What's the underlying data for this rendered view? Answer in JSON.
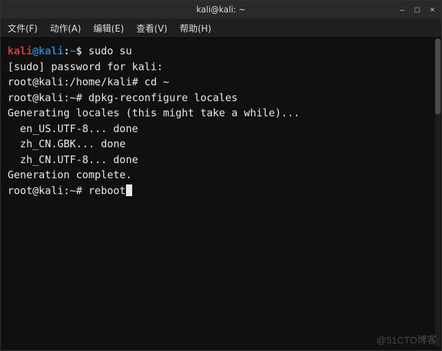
{
  "titlebar": {
    "title": "kali@kali: ~"
  },
  "window_controls": {
    "minimize": "–",
    "maximize": "□",
    "close": "×"
  },
  "menubar": {
    "file": "文件(F)",
    "actions": "动作(A)",
    "edit": "编辑(E)",
    "view": "查看(V)",
    "help": "帮助(H)"
  },
  "prompt1": {
    "user": "kali",
    "at": "@",
    "host": "kali",
    "colon": ":",
    "path": "~",
    "sym": "$",
    "cmd": " sudo su"
  },
  "lines": {
    "l2": "[sudo] password for kali:",
    "l3": "root@kali:/home/kali# cd ~",
    "l4": "root@kali:~# dpkg-reconfigure locales",
    "l5": "Generating locales (this might take a while)...",
    "l6": "  en_US.UTF-8... done",
    "l7": "  zh_CN.GBK... done",
    "l8": "  zh_CN.UTF-8... done",
    "l9": "Generation complete.",
    "l10_prompt": "root@kali:~# ",
    "l10_cmd": "reboot"
  },
  "watermark": "@51CTO博客"
}
